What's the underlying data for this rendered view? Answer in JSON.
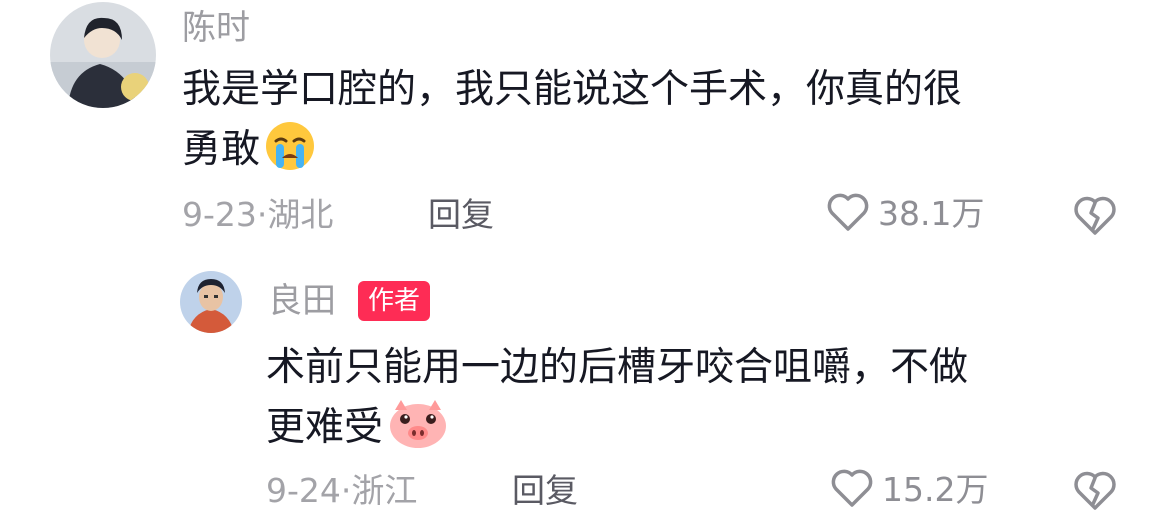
{
  "comments": [
    {
      "username": "陈时",
      "content_lines": [
        "我是学口腔的，我只能说这个手术，你真的很",
        "勇敢"
      ],
      "emoji": "loudly-crying-face",
      "date": "9-23",
      "location": "湖北",
      "meta_separator": "·",
      "reply_label": "回复",
      "like_count": "38.1万"
    },
    {
      "username": "良田",
      "badge": "作者",
      "content_lines": [
        "术前只能用一边的后槽牙咬合咀嚼，不做",
        "更难受"
      ],
      "emoji": "pig-face",
      "date": "9-24",
      "location": "浙江",
      "meta_separator": "·",
      "reply_label": "回复",
      "like_count": "15.2万"
    }
  ],
  "colors": {
    "text": "#161823",
    "muted": "#9d9da2",
    "badge": "#fe2c55"
  },
  "icons": {
    "like": "heart-outline-icon",
    "dislike": "broken-heart-outline-icon"
  }
}
